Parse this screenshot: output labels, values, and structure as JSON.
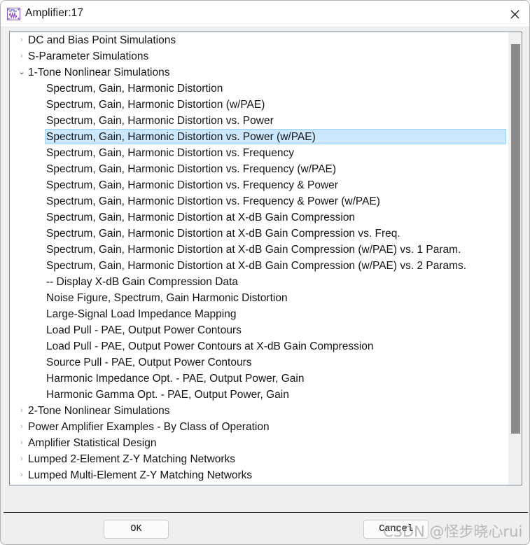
{
  "window": {
    "title": "Amplifier:17",
    "icon": "amplifier-schematic-icon",
    "close_icon": "close-icon"
  },
  "colors": {
    "selection_fill": "#cce8ff",
    "selection_border": "#99d1ff",
    "panel_border": "#7a8999",
    "dialog_bg": "#efefef",
    "scrollbar_thumb": "#8b8b8b",
    "separator": "#1d1d1d",
    "icon_accent": "#8a4fbf"
  },
  "tree": {
    "collapsed_glyph": "›",
    "expanded_glyph": "⌄",
    "items": [
      {
        "label": "DC and Bias Point Simulations",
        "depth": 0,
        "state": "collapsed",
        "selected": false
      },
      {
        "label": "S-Parameter Simulations",
        "depth": 0,
        "state": "collapsed",
        "selected": false
      },
      {
        "label": "1-Tone Nonlinear Simulations",
        "depth": 0,
        "state": "expanded",
        "selected": false
      },
      {
        "label": "Spectrum, Gain, Harmonic Distortion",
        "depth": 1,
        "state": "leaf",
        "selected": false
      },
      {
        "label": "Spectrum, Gain, Harmonic Distortion (w/PAE)",
        "depth": 1,
        "state": "leaf",
        "selected": false
      },
      {
        "label": "Spectrum, Gain, Harmonic Distortion vs. Power",
        "depth": 1,
        "state": "leaf",
        "selected": false
      },
      {
        "label": "Spectrum, Gain, Harmonic Distortion vs. Power (w/PAE)",
        "depth": 1,
        "state": "leaf",
        "selected": true
      },
      {
        "label": "Spectrum, Gain, Harmonic Distortion vs. Frequency",
        "depth": 1,
        "state": "leaf",
        "selected": false
      },
      {
        "label": "Spectrum, Gain, Harmonic Distortion vs. Frequency (w/PAE)",
        "depth": 1,
        "state": "leaf",
        "selected": false
      },
      {
        "label": "Spectrum, Gain, Harmonic Distortion vs. Frequency & Power",
        "depth": 1,
        "state": "leaf",
        "selected": false
      },
      {
        "label": "Spectrum, Gain, Harmonic Distortion vs. Frequency & Power (w/PAE)",
        "depth": 1,
        "state": "leaf",
        "selected": false
      },
      {
        "label": "Spectrum, Gain, Harmonic Distortion at X-dB Gain Compression",
        "depth": 1,
        "state": "leaf",
        "selected": false
      },
      {
        "label": "Spectrum, Gain, Harmonic Distortion at X-dB Gain Compression vs. Freq.",
        "depth": 1,
        "state": "leaf",
        "selected": false
      },
      {
        "label": "Spectrum, Gain, Harmonic Distortion at X-dB Gain Compression (w/PAE) vs. 1 Param.",
        "depth": 1,
        "state": "leaf",
        "selected": false
      },
      {
        "label": "Spectrum, Gain, Harmonic Distortion at X-dB Gain Compression (w/PAE) vs. 2 Params.",
        "depth": 1,
        "state": "leaf",
        "selected": false
      },
      {
        "label": "-- Display X-dB Gain Compression Data",
        "depth": 1,
        "state": "leaf",
        "selected": false
      },
      {
        "label": "Noise Figure, Spectrum, Gain Harmonic Distortion",
        "depth": 1,
        "state": "leaf",
        "selected": false
      },
      {
        "label": "Large-Signal Load Impedance Mapping",
        "depth": 1,
        "state": "leaf",
        "selected": false
      },
      {
        "label": "Load Pull - PAE, Output Power Contours",
        "depth": 1,
        "state": "leaf",
        "selected": false
      },
      {
        "label": "Load Pull - PAE, Output Power Contours at X-dB Gain Compression",
        "depth": 1,
        "state": "leaf",
        "selected": false
      },
      {
        "label": "Source Pull - PAE, Output Power Contours",
        "depth": 1,
        "state": "leaf",
        "selected": false
      },
      {
        "label": "Harmonic Impedance Opt. - PAE, Output Power, Gain",
        "depth": 1,
        "state": "leaf",
        "selected": false
      },
      {
        "label": "Harmonic Gamma Opt. - PAE, Output Power, Gain",
        "depth": 1,
        "state": "leaf",
        "selected": false
      },
      {
        "label": "2-Tone Nonlinear Simulations",
        "depth": 0,
        "state": "collapsed",
        "selected": false
      },
      {
        "label": "Power Amplifier Examples - By Class of Operation",
        "depth": 0,
        "state": "collapsed",
        "selected": false
      },
      {
        "label": "Amplifier Statistical Design",
        "depth": 0,
        "state": "collapsed",
        "selected": false
      },
      {
        "label": "Lumped 2-Element Z-Y Matching Networks",
        "depth": 0,
        "state": "collapsed",
        "selected": false
      },
      {
        "label": "Lumped Multi-Element Z-Y Matching Networks",
        "depth": 0,
        "state": "collapsed",
        "selected": false
      }
    ]
  },
  "footer": {
    "ok_label": "OK",
    "cancel_label": "Cancel"
  },
  "watermark": {
    "text": "CSDN @怪步晓心rui"
  }
}
